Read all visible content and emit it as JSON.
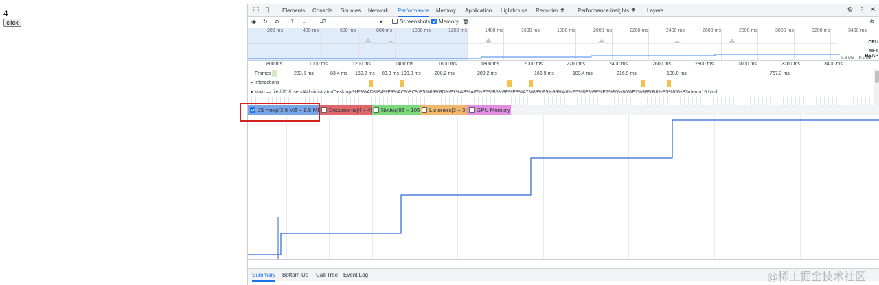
{
  "page": {
    "counter": "4",
    "button_label": "click"
  },
  "devtools": {
    "tabs": [
      "Elements",
      "Console",
      "Sources",
      "Network",
      "Performance",
      "Memory",
      "Application",
      "Lighthouse",
      "Recorder ⚗",
      "Performance insights ⚗",
      "Layers"
    ],
    "active_tab": "Performance",
    "toolbar": {
      "profile": "#3",
      "screenshots_label": "Screenshots",
      "screenshots_checked": false,
      "memory_label": "Memory",
      "memory_checked": true
    },
    "overview": {
      "ticks": [
        "200 ms",
        "400 ms",
        "600 ms",
        "800 ms",
        "1000 ms",
        "1200 ms",
        "1400 ms",
        "1600 ms",
        "1800 ms",
        "2000 ms",
        "2200 ms",
        "2400 ms",
        "2600 ms",
        "2800 ms",
        "3000 ms",
        "3200 ms",
        "3400 ms"
      ],
      "labels": {
        "cpu": "CPU",
        "net": "NET",
        "heap": "HEAP"
      },
      "heap_range": "3.8 MB – 9.5 MB"
    },
    "ruler_ticks": [
      "800 ms",
      "1000 ms",
      "1200 ms",
      "1400 ms",
      "1600 ms",
      "1800 ms",
      "2000 ms",
      "2200 ms",
      "2400 ms",
      "2600 ms",
      "2800 ms",
      "3000 ms",
      "3200 ms",
      "3400 ms"
    ],
    "tracks": {
      "frames_label": "Frames",
      "frame_times": [
        "233.5 ms",
        "83.4 ms",
        "150.2 ms",
        "83.3 ms",
        "100.0 ms",
        "200.2 ms",
        "200.2 ms",
        "166.9 ms",
        "183.4 ms",
        "216.9 ms",
        "100.0 ms",
        "767.3 ms"
      ],
      "interactions_label": "Interactions",
      "main_label": "Main — file:///C:/Users/Administrator/Desktop/%E9%AD%94%E9%AC%BC%E5%89%8D%E7%AB%AF/%E6%B5%8F%E8%A7%88%E5%99%A8%E5%8E%9F%E7%90%86%E7%9B%B8%E5%85%B3/demo15.html"
    },
    "counters": [
      {
        "label": "JS Heap[3.8 MB – 9.5 MB]",
        "checked": true,
        "color": "#7aa4e8"
      },
      {
        "label": "Documents[4 – 4]",
        "checked": false,
        "color": "#e0686a"
      },
      {
        "label": "Nodes[93 – 105]",
        "checked": false,
        "color": "#7ad97a"
      },
      {
        "label": "Listeners[3 – 3]",
        "checked": false,
        "color": "#f2b76a"
      },
      {
        "label": "GPU Memory",
        "checked": false,
        "color": "#e28ee0"
      }
    ],
    "bottom_tabs": [
      "Summary",
      "Bottom-Up",
      "Call Tree",
      "Event Log"
    ],
    "active_bottom_tab": "Summary"
  },
  "watermark": "@稀土掘金技术社区"
}
